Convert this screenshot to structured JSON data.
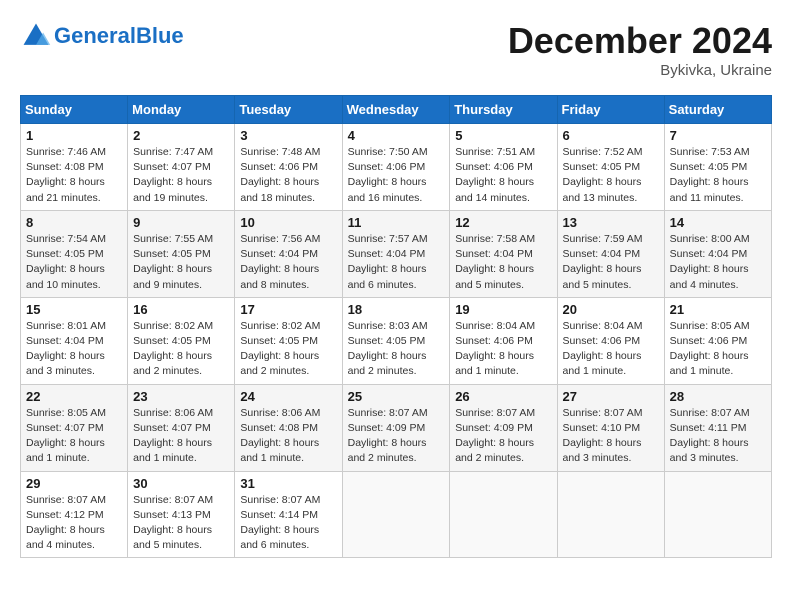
{
  "header": {
    "logo_general": "General",
    "logo_blue": "Blue",
    "month_title": "December 2024",
    "location": "Bykivka, Ukraine"
  },
  "days_of_week": [
    "Sunday",
    "Monday",
    "Tuesday",
    "Wednesday",
    "Thursday",
    "Friday",
    "Saturday"
  ],
  "weeks": [
    [
      {
        "day": "1",
        "info": "Sunrise: 7:46 AM\nSunset: 4:08 PM\nDaylight: 8 hours\nand 21 minutes."
      },
      {
        "day": "2",
        "info": "Sunrise: 7:47 AM\nSunset: 4:07 PM\nDaylight: 8 hours\nand 19 minutes."
      },
      {
        "day": "3",
        "info": "Sunrise: 7:48 AM\nSunset: 4:06 PM\nDaylight: 8 hours\nand 18 minutes."
      },
      {
        "day": "4",
        "info": "Sunrise: 7:50 AM\nSunset: 4:06 PM\nDaylight: 8 hours\nand 16 minutes."
      },
      {
        "day": "5",
        "info": "Sunrise: 7:51 AM\nSunset: 4:06 PM\nDaylight: 8 hours\nand 14 minutes."
      },
      {
        "day": "6",
        "info": "Sunrise: 7:52 AM\nSunset: 4:05 PM\nDaylight: 8 hours\nand 13 minutes."
      },
      {
        "day": "7",
        "info": "Sunrise: 7:53 AM\nSunset: 4:05 PM\nDaylight: 8 hours\nand 11 minutes."
      }
    ],
    [
      {
        "day": "8",
        "info": "Sunrise: 7:54 AM\nSunset: 4:05 PM\nDaylight: 8 hours\nand 10 minutes."
      },
      {
        "day": "9",
        "info": "Sunrise: 7:55 AM\nSunset: 4:05 PM\nDaylight: 8 hours\nand 9 minutes."
      },
      {
        "day": "10",
        "info": "Sunrise: 7:56 AM\nSunset: 4:04 PM\nDaylight: 8 hours\nand 8 minutes."
      },
      {
        "day": "11",
        "info": "Sunrise: 7:57 AM\nSunset: 4:04 PM\nDaylight: 8 hours\nand 6 minutes."
      },
      {
        "day": "12",
        "info": "Sunrise: 7:58 AM\nSunset: 4:04 PM\nDaylight: 8 hours\nand 5 minutes."
      },
      {
        "day": "13",
        "info": "Sunrise: 7:59 AM\nSunset: 4:04 PM\nDaylight: 8 hours\nand 5 minutes."
      },
      {
        "day": "14",
        "info": "Sunrise: 8:00 AM\nSunset: 4:04 PM\nDaylight: 8 hours\nand 4 minutes."
      }
    ],
    [
      {
        "day": "15",
        "info": "Sunrise: 8:01 AM\nSunset: 4:04 PM\nDaylight: 8 hours\nand 3 minutes."
      },
      {
        "day": "16",
        "info": "Sunrise: 8:02 AM\nSunset: 4:05 PM\nDaylight: 8 hours\nand 2 minutes."
      },
      {
        "day": "17",
        "info": "Sunrise: 8:02 AM\nSunset: 4:05 PM\nDaylight: 8 hours\nand 2 minutes."
      },
      {
        "day": "18",
        "info": "Sunrise: 8:03 AM\nSunset: 4:05 PM\nDaylight: 8 hours\nand 2 minutes."
      },
      {
        "day": "19",
        "info": "Sunrise: 8:04 AM\nSunset: 4:06 PM\nDaylight: 8 hours\nand 1 minute."
      },
      {
        "day": "20",
        "info": "Sunrise: 8:04 AM\nSunset: 4:06 PM\nDaylight: 8 hours\nand 1 minute."
      },
      {
        "day": "21",
        "info": "Sunrise: 8:05 AM\nSunset: 4:06 PM\nDaylight: 8 hours\nand 1 minute."
      }
    ],
    [
      {
        "day": "22",
        "info": "Sunrise: 8:05 AM\nSunset: 4:07 PM\nDaylight: 8 hours\nand 1 minute."
      },
      {
        "day": "23",
        "info": "Sunrise: 8:06 AM\nSunset: 4:07 PM\nDaylight: 8 hours\nand 1 minute."
      },
      {
        "day": "24",
        "info": "Sunrise: 8:06 AM\nSunset: 4:08 PM\nDaylight: 8 hours\nand 1 minute."
      },
      {
        "day": "25",
        "info": "Sunrise: 8:07 AM\nSunset: 4:09 PM\nDaylight: 8 hours\nand 2 minutes."
      },
      {
        "day": "26",
        "info": "Sunrise: 8:07 AM\nSunset: 4:09 PM\nDaylight: 8 hours\nand 2 minutes."
      },
      {
        "day": "27",
        "info": "Sunrise: 8:07 AM\nSunset: 4:10 PM\nDaylight: 8 hours\nand 3 minutes."
      },
      {
        "day": "28",
        "info": "Sunrise: 8:07 AM\nSunset: 4:11 PM\nDaylight: 8 hours\nand 3 minutes."
      }
    ],
    [
      {
        "day": "29",
        "info": "Sunrise: 8:07 AM\nSunset: 4:12 PM\nDaylight: 8 hours\nand 4 minutes."
      },
      {
        "day": "30",
        "info": "Sunrise: 8:07 AM\nSunset: 4:13 PM\nDaylight: 8 hours\nand 5 minutes."
      },
      {
        "day": "31",
        "info": "Sunrise: 8:07 AM\nSunset: 4:14 PM\nDaylight: 8 hours\nand 6 minutes."
      },
      {
        "day": "",
        "info": ""
      },
      {
        "day": "",
        "info": ""
      },
      {
        "day": "",
        "info": ""
      },
      {
        "day": "",
        "info": ""
      }
    ]
  ]
}
